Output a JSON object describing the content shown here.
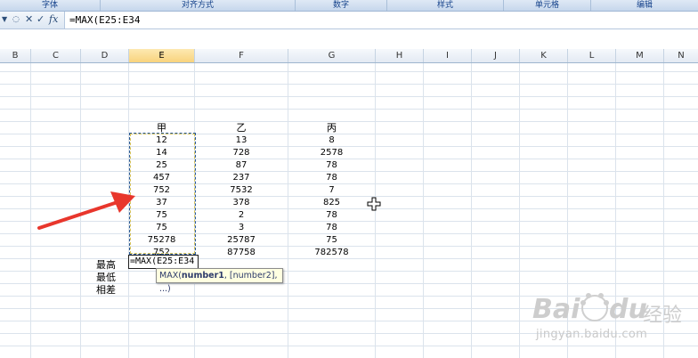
{
  "ribbon": {
    "groups": [
      "字体",
      "对齐方式",
      "数字",
      "样式",
      "单元格",
      "编辑"
    ]
  },
  "formula_bar": {
    "cancel_glyph": "✕",
    "enter_glyph": "✓",
    "fx_label": "fx",
    "formula": "=MAX(E25:E34"
  },
  "columns": [
    "B",
    "C",
    "D",
    "E",
    "F",
    "G",
    "H",
    "I",
    "J",
    "K",
    "L",
    "M",
    "N"
  ],
  "selected_column": "E",
  "table": {
    "headers": [
      "甲",
      "乙",
      "丙"
    ],
    "rows": [
      [
        "12",
        "13",
        "8"
      ],
      [
        "14",
        "728",
        "2578"
      ],
      [
        "25",
        "87",
        "78"
      ],
      [
        "457",
        "237",
        "78"
      ],
      [
        "752",
        "7532",
        "7"
      ],
      [
        "37",
        "378",
        "825"
      ],
      [
        "75",
        "2",
        "78"
      ],
      [
        "75",
        "3",
        "78"
      ],
      [
        "75278",
        "25787",
        "75"
      ],
      [
        "752",
        "87758",
        "782578"
      ]
    ]
  },
  "row_labels": [
    "最高",
    "最低",
    "相差"
  ],
  "editing_cell": "=MAX(E25:E34",
  "tooltip": {
    "fn": "MAX(",
    "arg1": "number1",
    "rest": ", [number2], ...)"
  },
  "watermark": {
    "brand": "Bai",
    "brand2": "du",
    "cn": "经验",
    "url": "jingyan.baidu.com"
  },
  "colors": {
    "arrow": "#e8362c",
    "selected_header": "#f8d37d",
    "marquee": "#2b5a96"
  }
}
